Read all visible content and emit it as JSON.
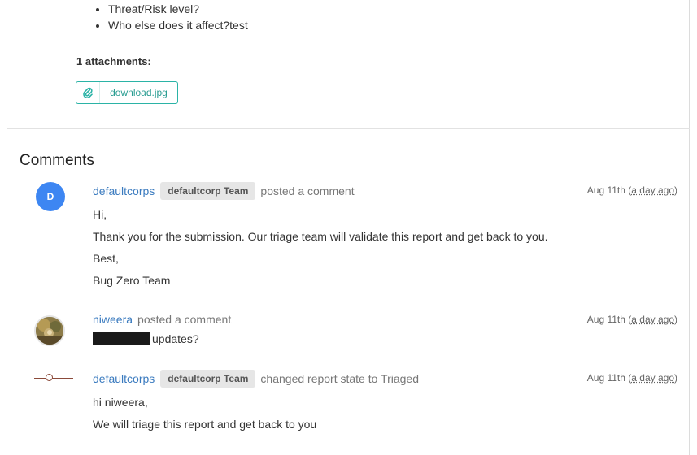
{
  "description_bullets": [
    "Threat/Risk level?",
    "Who else does it affect?test"
  ],
  "attachments": {
    "title": "1 attachments:",
    "file_name": "download.jpg",
    "icon": "paperclip-icon"
  },
  "comments_title": "Comments",
  "comments": [
    {
      "avatar_letter": "D",
      "author": "defaultcorps",
      "team_badge": "defaultcorp Team",
      "action": "posted a comment",
      "date": "Aug 11th",
      "relative": "a day ago",
      "lines": [
        "Hi,",
        "Thank you for the submission. Our triage team will validate this report and get back to you.",
        "Best,",
        "Bug Zero Team"
      ]
    },
    {
      "author": "niweera",
      "action": "posted a comment",
      "date": "Aug 11th",
      "relative": "a day ago",
      "message": "updates?"
    },
    {
      "author": "defaultcorps",
      "team_badge": "defaultcorp Team",
      "action": "changed report state to Triaged",
      "date": "Aug 11th",
      "relative": "a day ago",
      "lines": [
        "hi niweera,",
        "We will triage this report and get back to you"
      ]
    }
  ],
  "colors": {
    "accent": "#2bb3a6",
    "link": "#3b7bbf",
    "avatar": "#3d86f2",
    "event_node": "#8b4a3a"
  }
}
